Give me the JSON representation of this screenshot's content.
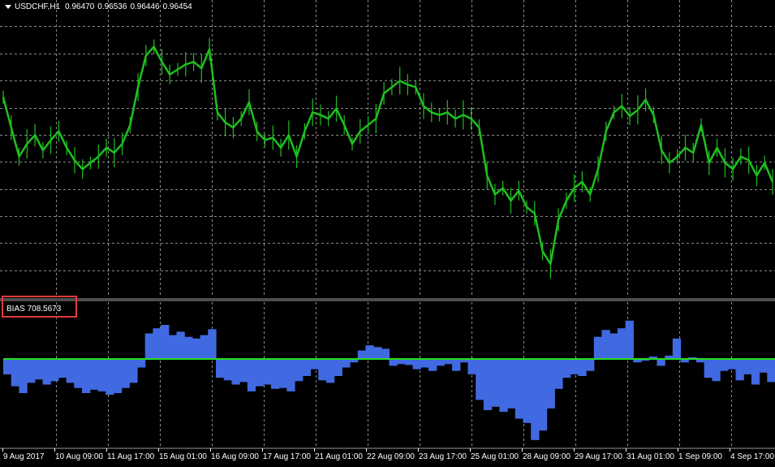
{
  "header": {
    "symbol": "USDCHF,H1",
    "quotes": [
      "0.96470",
      "0.96536",
      "0.96446",
      "0.96454"
    ]
  },
  "indicator": {
    "name": "BIAS",
    "value": "708.5673",
    "label": "BIAS 708.5673"
  },
  "x_labels": [
    "9 Aug 2017",
    "10 Aug 09:00",
    "11 Aug 17:00",
    "15 Aug 01:00",
    "16 Aug 09:00",
    "17 Aug 17:00",
    "21 Aug 01:00",
    "22 Aug 09:00",
    "23 Aug 17:00",
    "25 Aug 01:00",
    "28 Aug 09:00",
    "29 Aug 17:00",
    "31 Aug 01:00",
    "1 Sep 09:00",
    "4 Sep 17:00"
  ],
  "colors": {
    "background": "#000000",
    "grid": "#8a8a8a",
    "price": "#1fbf1f",
    "histogram": "#4169e1",
    "zero_line": "#22dd22",
    "highlight_box": "#e03c3c",
    "text": "#ffffff"
  },
  "chart_data": [
    {
      "type": "line",
      "title": "USDCHF,H1",
      "series": [
        {
          "name": "USDCHF",
          "values": [
            0.9752,
            0.9728,
            0.9705,
            0.9715,
            0.9722,
            0.971,
            0.9718,
            0.9725,
            0.9712,
            0.9702,
            0.9695,
            0.97,
            0.9705,
            0.9712,
            0.9708,
            0.9715,
            0.973,
            0.976,
            0.9785,
            0.9792,
            0.978,
            0.977,
            0.9774,
            0.9778,
            0.978,
            0.9775,
            0.979,
            0.974,
            0.9732,
            0.9728,
            0.9735,
            0.9748,
            0.9725,
            0.9718,
            0.972,
            0.9712,
            0.9722,
            0.9705,
            0.9725,
            0.974,
            0.9738,
            0.9735,
            0.9743,
            0.973,
            0.9715,
            0.9725,
            0.973,
            0.9735,
            0.9755,
            0.976,
            0.9765,
            0.9762,
            0.976,
            0.9745,
            0.974,
            0.9738,
            0.974,
            0.9735,
            0.9738,
            0.9735,
            0.9728,
            0.969,
            0.9675,
            0.968,
            0.967,
            0.9678,
            0.9665,
            0.966,
            0.963,
            0.962,
            0.9655,
            0.967,
            0.968,
            0.9685,
            0.9675,
            0.9695,
            0.9725,
            0.974,
            0.9745,
            0.9737,
            0.9742,
            0.975,
            0.9738,
            0.971,
            0.97,
            0.9705,
            0.9712,
            0.9708,
            0.973,
            0.97,
            0.9712,
            0.97,
            0.9695,
            0.9705,
            0.9702,
            0.969,
            0.97,
            0.9685
          ]
        }
      ]
    },
    {
      "type": "bar",
      "title": "BIAS",
      "series": [
        {
          "name": "BIAS",
          "values": [
            -18,
            -32,
            -40,
            -28,
            -24,
            -30,
            -26,
            -22,
            -28,
            -34,
            -40,
            -36,
            -38,
            -42,
            -40,
            -34,
            -28,
            -10,
            30,
            36,
            40,
            28,
            32,
            26,
            24,
            28,
            35,
            -22,
            -25,
            -30,
            -27,
            -38,
            -32,
            -30,
            -35,
            -34,
            -38,
            -26,
            -20,
            -12,
            -25,
            -28,
            -20,
            -10,
            -4,
            10,
            16,
            14,
            12,
            -8,
            -6,
            -7,
            -12,
            -10,
            -14,
            -8,
            -6,
            -14,
            -4,
            -18,
            -48,
            -60,
            -56,
            -62,
            -58,
            -70,
            -75,
            -95,
            -84,
            -58,
            -35,
            -22,
            -18,
            -20,
            -14,
            26,
            34,
            30,
            36,
            45,
            -4,
            -2,
            3,
            -8,
            4,
            24,
            -4,
            2,
            -4,
            -22,
            -26,
            -14,
            -12,
            -25,
            -18,
            -30,
            -16,
            -27
          ]
        }
      ]
    }
  ]
}
